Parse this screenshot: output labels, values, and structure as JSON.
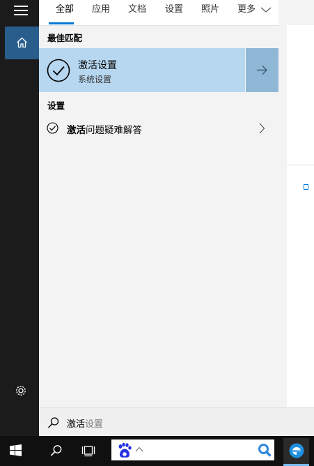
{
  "tabs": [
    {
      "label": "全部"
    },
    {
      "label": "应用"
    },
    {
      "label": "文档"
    },
    {
      "label": "设置"
    },
    {
      "label": "照片"
    },
    {
      "label": "更多"
    }
  ],
  "sections": {
    "best_match": "最佳匹配",
    "settings": "设置"
  },
  "best_match": {
    "title": "激活设置",
    "subtitle": "系统设置"
  },
  "settings_results": [
    {
      "bold": "激活",
      "rest": "问题疑难解答"
    }
  ],
  "search": {
    "typed": "激活",
    "suggestion": "设置"
  },
  "icons": {
    "hamburger": "hamburger-menu-icon",
    "home": "home-icon",
    "settings": "gear-icon",
    "result": "check-circle-icon",
    "arrow": "arrow-right-icon",
    "chevron": "chevron-right-icon",
    "search": "search-icon",
    "start": "windows-logo-icon",
    "task_view": "task-view-icon",
    "baidu": "baidu-paw-icon",
    "ie": "internet-explorer-icon"
  },
  "colors": {
    "accent": "#0078d7",
    "best_match_bg": "#b7d7f0",
    "rail_bg": "#1b1b1b",
    "home_bg": "#295d8c",
    "taskbar_bg": "#101010"
  }
}
